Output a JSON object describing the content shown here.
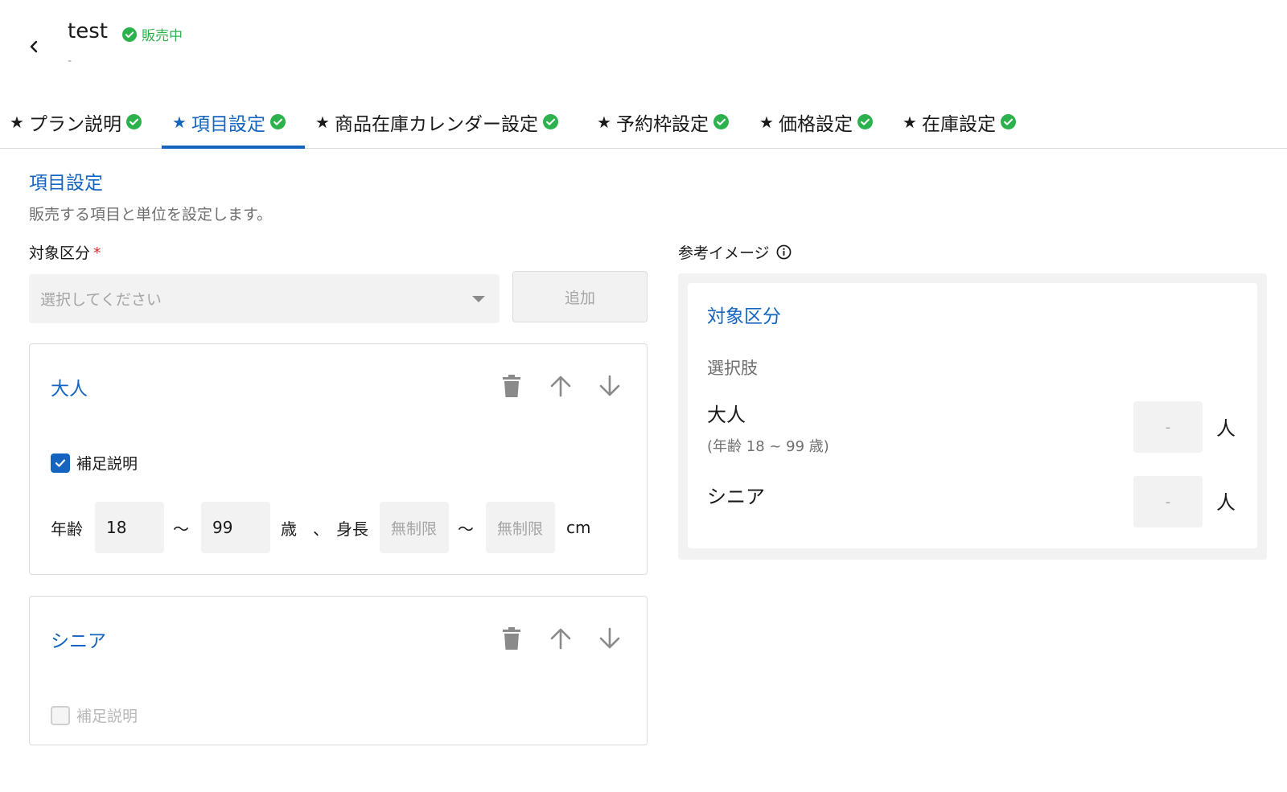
{
  "header": {
    "title": "test",
    "status": "販売中",
    "subtitle": "-"
  },
  "tabs": [
    {
      "star": "★",
      "label": "プラン説明",
      "active": false
    },
    {
      "star": "★",
      "label": "項目設定",
      "active": true
    },
    {
      "star": "★",
      "label": "商品在庫カレンダー設定",
      "active": false
    },
    {
      "star": "★",
      "label": "予約枠設定",
      "active": false
    },
    {
      "star": "★",
      "label": "価格設定",
      "active": false
    },
    {
      "star": "★",
      "label": "在庫設定",
      "active": false
    }
  ],
  "section": {
    "title": "項目設定",
    "description": "販売する項目と単位を設定します。"
  },
  "target_field": {
    "label": "対象区分",
    "required_mark": "*",
    "placeholder": "選択してください",
    "add_label": "追加"
  },
  "items": [
    {
      "name": "大人",
      "note_label": "補足説明",
      "note_checked": true,
      "age_label": "年齢",
      "age_min": "18",
      "tilde": "〜",
      "age_max": "99",
      "age_unit": "歳",
      "separator": "、",
      "height_label": "身長",
      "height_min_placeholder": "無制限",
      "height_max_placeholder": "無制限",
      "height_unit": "cm"
    },
    {
      "name": "シニア",
      "note_label": "補足説明",
      "note_checked": false
    }
  ],
  "reference": {
    "label": "参考イメージ",
    "title": "対象区分",
    "subtitle": "選択肢",
    "rows": [
      {
        "name": "大人",
        "note": "(年齢 18 ~ 99 歳)",
        "qty": "-",
        "unit": "人"
      },
      {
        "name": "シニア",
        "note": "",
        "qty": "-",
        "unit": "人"
      }
    ]
  },
  "colors": {
    "accent": "#1565c0",
    "success": "#2bb24c",
    "required": "#d32f2f"
  },
  "icons": {
    "back": "chevron-left-icon",
    "status": "check-circle-icon",
    "delete": "trash-icon",
    "up": "arrow-up-icon",
    "down": "arrow-down-icon",
    "info": "info-icon"
  }
}
